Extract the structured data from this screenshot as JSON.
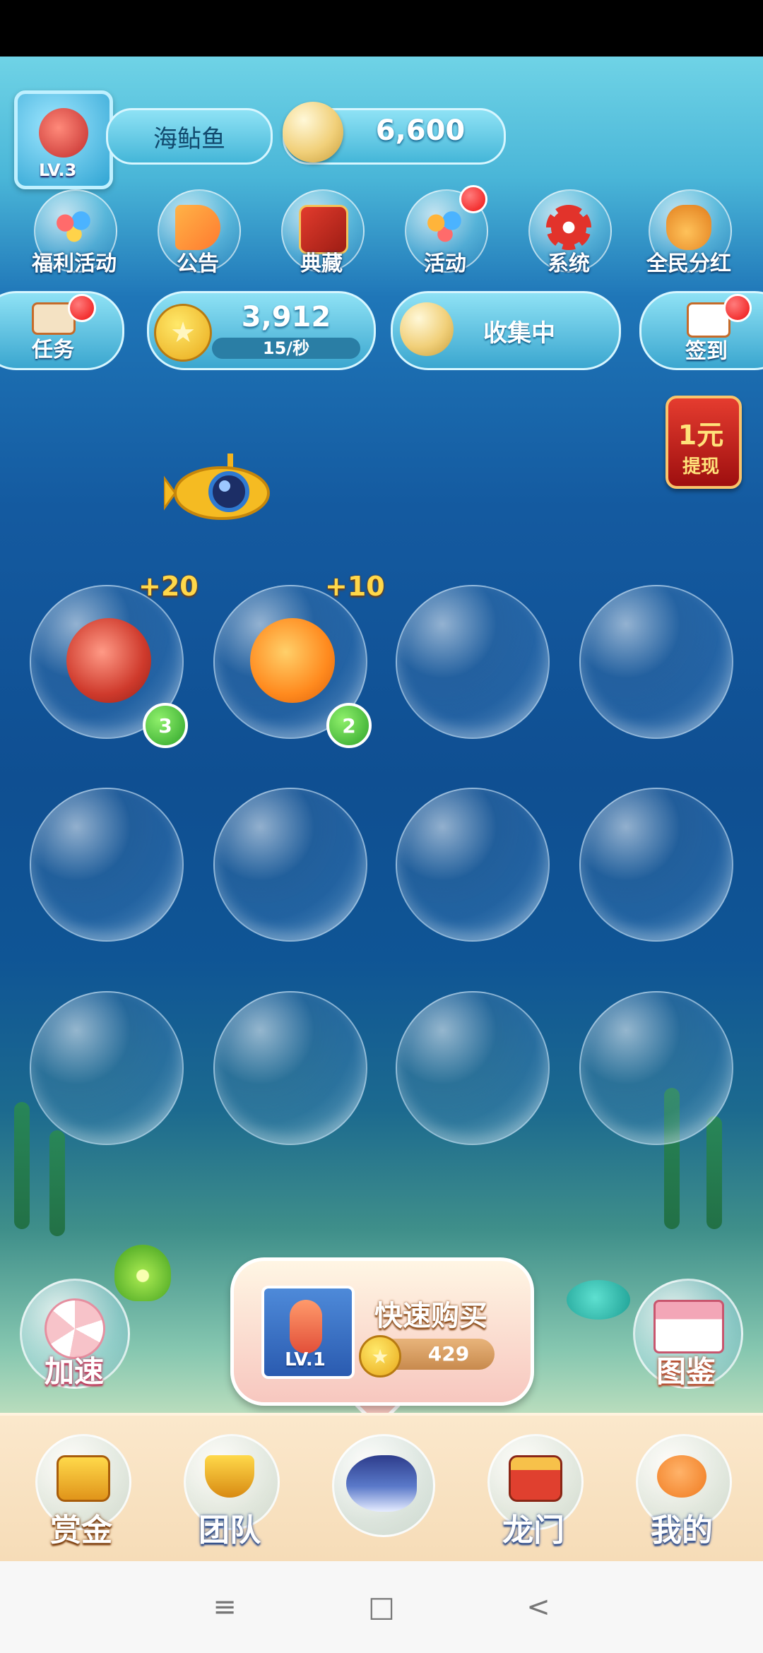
{
  "player": {
    "name": "海鲇鱼",
    "level": "LV.3",
    "pearls": "6,600"
  },
  "menu": [
    {
      "label": "福利活动",
      "icon": "balloons-icon",
      "badge": false
    },
    {
      "label": "公告",
      "icon": "megaphone-icon",
      "badge": false
    },
    {
      "label": "典藏",
      "icon": "book-icon",
      "badge": false
    },
    {
      "label": "活动",
      "icon": "balloons-icon",
      "badge": true
    },
    {
      "label": "系统",
      "icon": "gear-icon",
      "badge": false
    },
    {
      "label": "全民分红",
      "icon": "money-bag-icon",
      "badge": false
    }
  ],
  "tasks": {
    "label": "任务",
    "badge": true
  },
  "coins": {
    "value": "3,912",
    "rate": "15/秒"
  },
  "collect": {
    "label": "收集中"
  },
  "signin": {
    "label": "签到",
    "badge": true
  },
  "withdraw": {
    "main": "1元",
    "sub": "提现"
  },
  "bubbles": [
    {
      "fish": "red-fish",
      "level": "3",
      "bonus": "+20"
    },
    {
      "fish": "orange-fish",
      "level": "2",
      "bonus": "+10"
    },
    {
      "fish": null
    },
    {
      "fish": null
    },
    {
      "fish": null
    },
    {
      "fish": null
    },
    {
      "fish": null
    },
    {
      "fish": null
    },
    {
      "fish": null
    },
    {
      "fish": null
    },
    {
      "fish": null
    },
    {
      "fish": null
    }
  ],
  "controls": {
    "speed": "加速",
    "guide": "图鉴"
  },
  "quick_buy": {
    "title": "快速购买",
    "level": "LV.1",
    "price": "429"
  },
  "tabs": [
    {
      "label": "赏金",
      "icon": "treasure-icon"
    },
    {
      "label": "团队",
      "icon": "trophy-icon"
    },
    {
      "label": "",
      "icon": "fish-icon"
    },
    {
      "label": "龙门",
      "icon": "dragon-gate-icon"
    },
    {
      "label": "我的",
      "icon": "smile-icon"
    }
  ],
  "system_nav": {
    "menu": "≡",
    "home": "□",
    "back": "<"
  },
  "colors": {
    "ocean": "#145aa0",
    "gold": "#ffd84a",
    "badge_red": "#e11111",
    "level_green": "#2ea32a"
  }
}
